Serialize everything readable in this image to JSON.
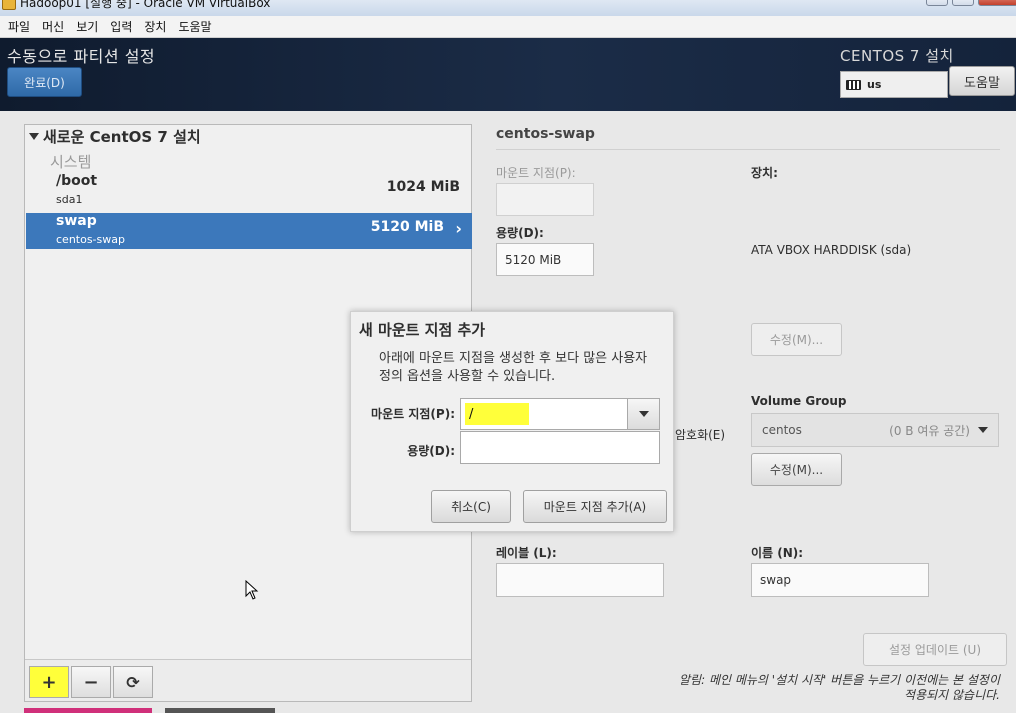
{
  "window": {
    "title": "Hadoop01 [실행 중] - Oracle VM VirtualBox",
    "menu": [
      "파일",
      "머신",
      "보기",
      "입력",
      "장치",
      "도움말"
    ]
  },
  "header": {
    "spoke_title": "수동으로 파티션 설정",
    "done_label": "완료(D)",
    "product": "CENTOS 7 설치",
    "keyboard_layout": "us",
    "help_label": "도움말"
  },
  "left": {
    "install_title": "새로운 CentOS 7 설치",
    "system_label": "시스템",
    "mounts": [
      {
        "name": "/boot",
        "device": "sda1",
        "size": "1024 MiB"
      },
      {
        "name": "swap",
        "device": "centos-swap",
        "size": "5120 MiB"
      }
    ],
    "toolbar": {
      "add": "+",
      "remove": "−",
      "refresh": "⟳"
    }
  },
  "right": {
    "title": "centos-swap",
    "mount_point_label": "마운트 지점(P):",
    "mount_point_value": "",
    "capacity_label": "용량(D):",
    "capacity_value": "5120 MiB",
    "device_label": "장치:",
    "device_value": "ATA VBOX HARDDISK (sda)",
    "modify_label": "수정(M)...",
    "encrypt_label": "암호화(E)",
    "volume_group_label": "Volume Group",
    "volume_group_value": "centos",
    "volume_group_free": "(0 B 여유 공간)",
    "modify2_label": "수정(M)...",
    "label_label": "레이블 (L):",
    "label_value": "",
    "name_label": "이름 (N):",
    "name_value": "swap",
    "update_label": "설정 업데이트 (U)",
    "note": "알림: 메인 메뉴의 '설치 시작' 버튼을 누르기 이전에는 본 설정이 적용되지 않습니다."
  },
  "dialog": {
    "title": "새 마운트 지점 추가",
    "description": "아래에 마운트 지점을 생성한 후 보다 많은 사용자 정의 옵션을 사용할 수 있습니다.",
    "mount_label": "마운트 지점(P):",
    "mount_value": "/",
    "capacity_label": "용량(D):",
    "capacity_value": "",
    "cancel_label": "취소(C)",
    "add_label": "마운트 지점 추가(A)"
  },
  "colors": {
    "header_bg": "#14233b",
    "accent_blue": "#3c78bb",
    "highlight_yellow": "#ffff3a"
  }
}
